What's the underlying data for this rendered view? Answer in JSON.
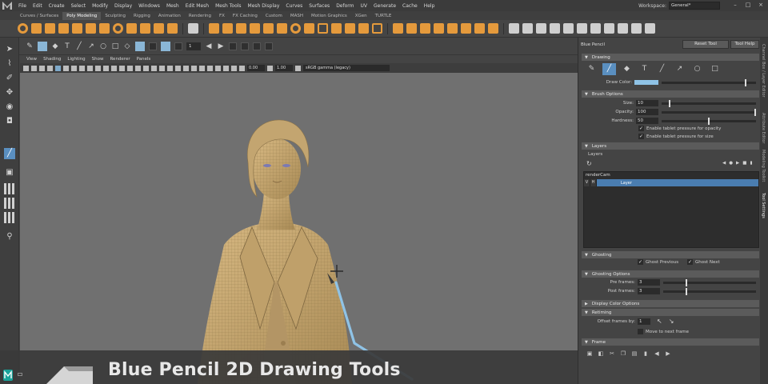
{
  "menubar": {
    "items": [
      "File",
      "Edit",
      "Create",
      "Select",
      "Modify",
      "Display",
      "Windows",
      "Mesh",
      "Edit Mesh",
      "Mesh Tools",
      "Mesh Display",
      "Curves",
      "Surfaces",
      "Deform",
      "UV",
      "Generate",
      "Cache",
      "Help"
    ],
    "workspace_label": "Workspace:",
    "workspace_value": "General*"
  },
  "shelf_tabs": [
    "Curves / Surfaces",
    "Poly Modeling",
    "Sculpting",
    "Rigging",
    "Animation",
    "Rendering",
    "FX",
    "FX Caching",
    "Custom",
    "MASH",
    "Motion Graphics",
    "XGen",
    "TURTLE"
  ],
  "shelf_active": "Poly Modeling",
  "status": {
    "field_value": "1"
  },
  "viewport": {
    "menu": [
      "View",
      "Shading",
      "Lighting",
      "Show",
      "Renderer",
      "Panels"
    ],
    "exposure": "0.00",
    "gamma": "1.00",
    "color_space": "sRGB gamma (legacy)"
  },
  "banner": {
    "title": "Blue Pencil 2D Drawing Tools"
  },
  "panel": {
    "title": "Blue Pencil",
    "reset_tool": "Reset Tool",
    "tool_help": "Tool Help",
    "sections": {
      "drawing": "Drawing",
      "brush_options": "Brush Options",
      "layers": "Layers",
      "ghosting": "Ghosting",
      "ghosting_options": "Ghosting Options",
      "display_color_options": "Display Color Options",
      "retiming": "Retiming",
      "frame": "Frame"
    },
    "draw_color_label": "Draw Color:",
    "draw_color": "#8fc3e6",
    "brush": {
      "size_label": "Size:",
      "size_value": "10",
      "size_fraction": 0.08,
      "opacity_label": "Opacity:",
      "opacity_value": "100",
      "opacity_fraction": 1.0,
      "hardness_label": "Hardness:",
      "hardness_value": "50",
      "hardness_fraction": 0.5,
      "tablet_opacity": "Enable tablet pressure for opacity",
      "tablet_size": "Enable tablet pressure for size"
    },
    "layers": {
      "sub_label": "Layers",
      "camera": "renderCam",
      "layer_name": "Layer",
      "visible_flag": "V",
      "h_flag": "H"
    },
    "ghosting": {
      "previous": "Ghost Previous",
      "next": "Ghost Next"
    },
    "ghosting_options": {
      "pre_label": "Pre frames:",
      "pre_value": "3",
      "post_label": "Post frames:",
      "post_value": "3"
    },
    "retiming": {
      "offset_label": "Offset frames by:",
      "offset_value": "1",
      "move_next": "Move to next frame"
    }
  },
  "side_tabs": [
    "Channel Box / Layer Editor",
    "Attribute Editor",
    "Modeling Toolkit",
    "Tool Settings"
  ],
  "colors": {
    "accent": "#5a8fc0",
    "shelf_icon": "#e59a3c",
    "stroke": "#8fc3e6"
  }
}
